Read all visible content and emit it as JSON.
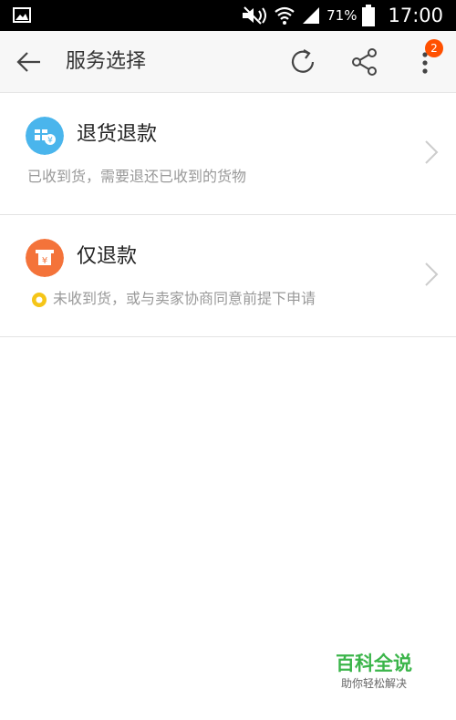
{
  "status_bar": {
    "battery_percent": "71%",
    "time": "17:00"
  },
  "app_bar": {
    "title": "服务选择",
    "badge_count": "2"
  },
  "options": [
    {
      "title": "退货退款",
      "description": "已收到货，需要退还已收到的货物",
      "icon": "gift-yuan-icon",
      "color": "#4ab5ec"
    },
    {
      "title": "仅退款",
      "description": "未收到货，或与卖家协商同意前提下申请",
      "icon": "atm-yuan-icon",
      "color": "#f4733a",
      "tip_icon_color": "#f5c518"
    }
  ],
  "watermark": {
    "main": "百科全说",
    "sub": "助你轻松解决"
  }
}
